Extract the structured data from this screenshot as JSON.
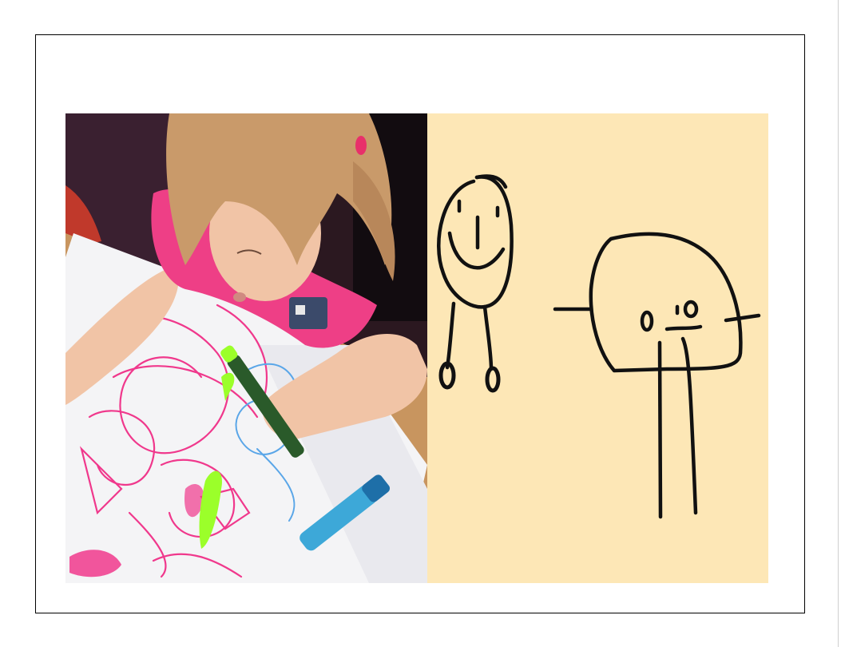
{
  "slide": {
    "background": "#ffffff",
    "border_color": "#000000"
  },
  "photo": {
    "subject": "child-drawing-photo",
    "colors": {
      "backdrop": "#2a1a22",
      "table": "#c8955f",
      "paper": "#f4f4f6",
      "shirt": "#ee3f86",
      "hair": "#c99a6a",
      "skin": "#f1c4a6",
      "pink_scribble": "#f0388c",
      "green_marker": "#9bff2a",
      "blue_scribble": "#5aa6e8",
      "marker_cap": "#3da8d8"
    }
  },
  "drawing": {
    "subject": "stick-figure-drawing",
    "colors": {
      "background": "#fde7b6",
      "ink": "#111111"
    }
  }
}
